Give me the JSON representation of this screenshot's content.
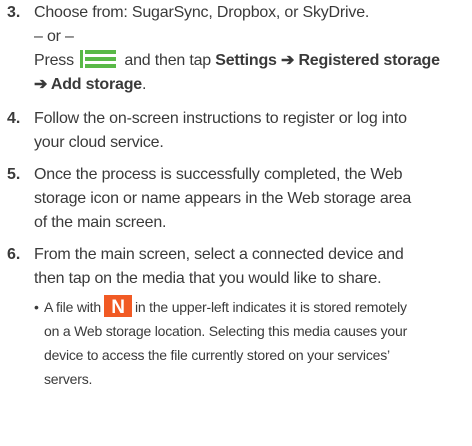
{
  "steps": [
    {
      "number": "3.",
      "line1": "Choose from: SugarSync, Dropbox, or SkyDrive.",
      "or": "– or –",
      "press_pre": "Press",
      "press_mid": "and then tap",
      "path_part1": "Settings ➔ Registered storage",
      "path_part2": "➔ Add storage",
      "period": "."
    },
    {
      "number": "4.",
      "lines": [
        "Follow the on-screen instructions to register or log into",
        "your cloud service."
      ]
    },
    {
      "number": "5.",
      "lines": [
        "Once the process is successfully completed, the Web",
        "storage icon or name appears in the Web storage area",
        "of the main screen."
      ]
    },
    {
      "number": "6.",
      "lines": [
        "From the main screen, select a connected device and",
        "then tap on the media that you would like to share."
      ]
    }
  ],
  "bullet": {
    "marker": "•",
    "pre": "A file with",
    "post": "in the upper-left indicates it is stored remotely",
    "lines": [
      "on a Web storage location. Selecting this media causes your",
      "device to access the file currently stored on your services’",
      "servers."
    ]
  },
  "icons": {
    "menu_key": "menu-key-icon",
    "web_storage": "web-storage-n-icon"
  },
  "colors": {
    "text": "#3a3a3a",
    "menu_key": "#59b947",
    "storage_icon_bg": "#f15a24",
    "storage_icon_fg": "#ffffff"
  }
}
